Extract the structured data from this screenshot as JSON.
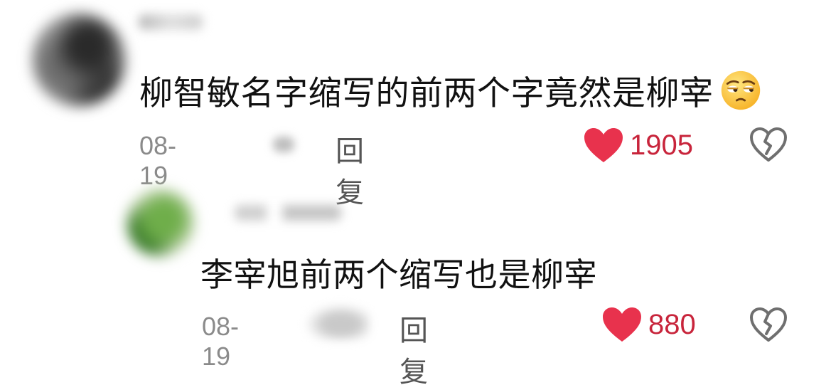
{
  "comments": [
    {
      "text": "柳智敏名字缩写的前两个字竟然是柳宰",
      "emoji": "unamused-face-emoji",
      "date": "08-19",
      "reply_label": "回复",
      "like_count": "1905",
      "liked": true
    },
    {
      "text": "李宰旭前两个缩写也是柳宰",
      "date": "08-19",
      "reply_label": "回复",
      "like_count": "880",
      "liked": true
    }
  ],
  "colors": {
    "like_red": "#e8324d",
    "like_count": "#c8243b",
    "meta_gray": "#8a8a8a",
    "icon_gray": "#6f6f6f"
  },
  "icons": {
    "like": "heart-icon",
    "dislike": "broken-heart-icon"
  }
}
